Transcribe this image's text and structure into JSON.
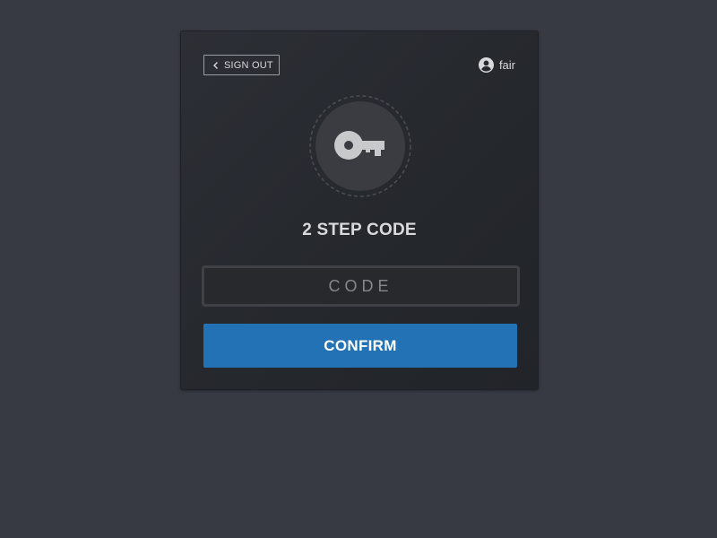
{
  "header": {
    "sign_out_label": "SIGN OUT",
    "username": "fair"
  },
  "main": {
    "title": "2 STEP CODE",
    "code_placeholder": "CODE",
    "code_value": "",
    "confirm_label": "CONFIRM"
  },
  "icons": {
    "back": "chevron-left-icon",
    "user": "user-circle-icon",
    "key": "key-icon"
  },
  "colors": {
    "page_background": "#373a43",
    "card_background": "#272a30",
    "accent": "#2272b5",
    "icon_circle": "#3a3c42"
  }
}
